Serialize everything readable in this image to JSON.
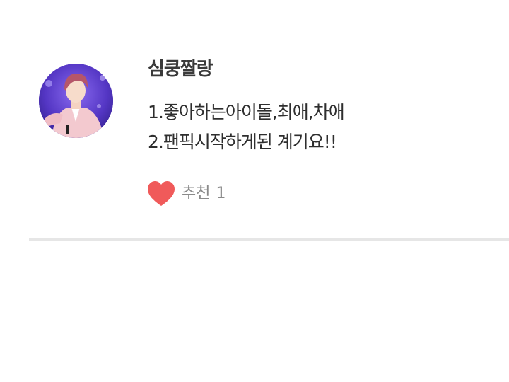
{
  "comment": {
    "author": "심쿵짤랑",
    "body_lines": [
      "1.좋아하는아이돌,최애,차애",
      "2.팬픽시작하게된 계기요!!"
    ],
    "recommend": {
      "icon": "heart-icon",
      "label": "추천",
      "count": "1",
      "color": "#f05a5a"
    },
    "avatar_icon": "profile-photo"
  }
}
